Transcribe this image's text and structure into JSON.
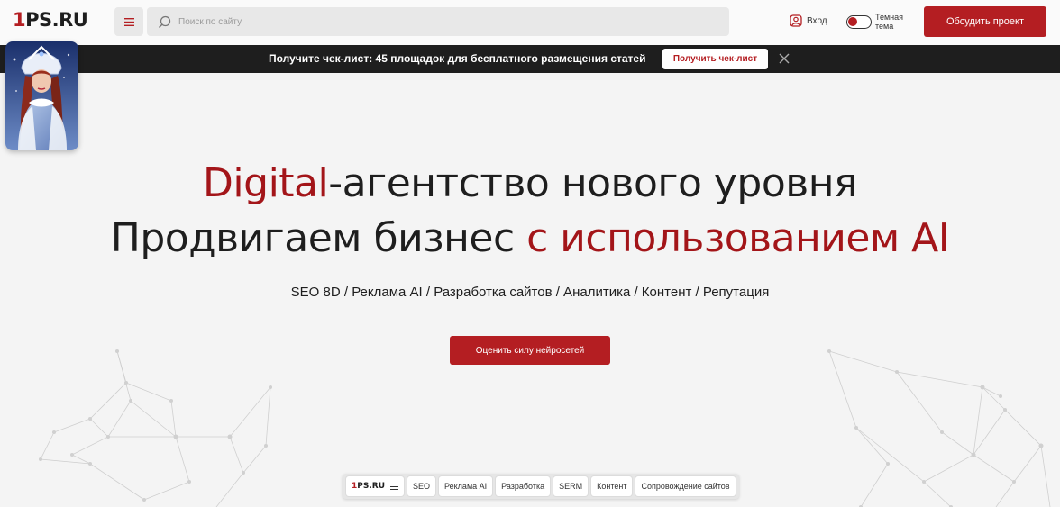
{
  "header": {
    "logo_prefix": "1",
    "logo_rest": "PS.RU",
    "menu_icon": "hamburger-icon",
    "search_placeholder": "Поиск по сайту",
    "login_label": "Вход",
    "theme_label": "Темная тема",
    "cta_label": "Обсудить проект"
  },
  "banner": {
    "text": "Получите чек-лист: 45 площадок для бесплатного размещения статей",
    "button_label": "Получить чек-лист"
  },
  "hero": {
    "line1_accent": "Digital",
    "line1_rest": "-агентство нового уровня",
    "line2_start": "Продвигаем бизнес ",
    "line2_accent": "с использованием AI",
    "services": "SEO 8D / Реклама AI / Разработка сайтов / Аналитика / Контент / Репутация",
    "button_label": "Оценить силу нейросетей"
  },
  "bottom_nav": {
    "logo_prefix": "1",
    "logo_rest": "PS.RU",
    "items": [
      "SEO",
      "Реклама AI",
      "Разработка",
      "SERM",
      "Контент",
      "Сопровождение сайтов"
    ]
  },
  "colors": {
    "accent": "#b41e22",
    "dark": "#1e1e1e",
    "background": "#f4f4f4"
  }
}
